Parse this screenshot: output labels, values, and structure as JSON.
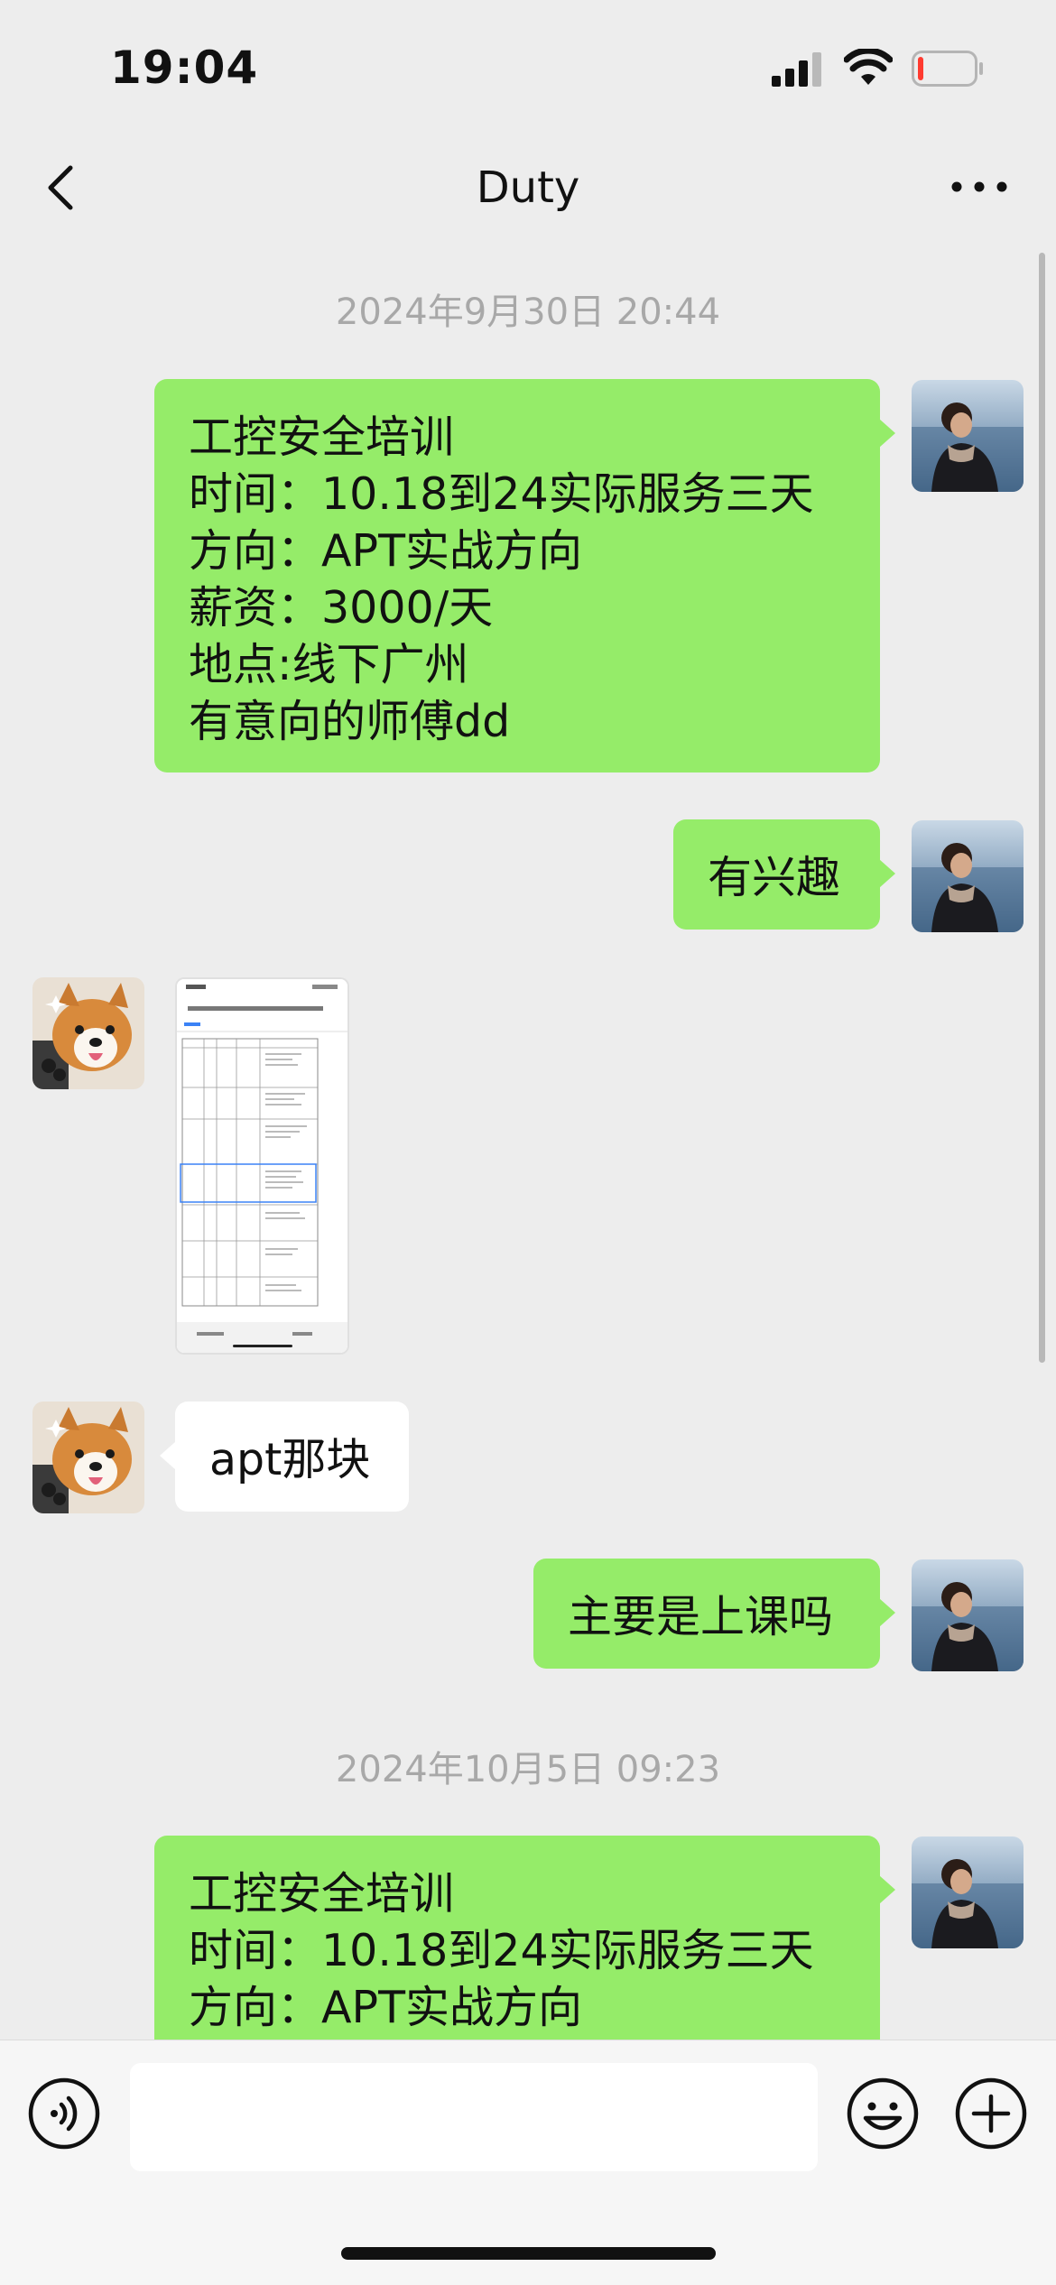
{
  "status_bar": {
    "time": "19:04",
    "battery_level": 0.1
  },
  "nav": {
    "title": "Duty"
  },
  "conversation": {
    "timestamps": [
      "2024年9月30日 20:44",
      "2024年10月5日 09:23"
    ],
    "messages": [
      {
        "sender": "me",
        "lines": [
          "工控安全培训",
          "时间：10.18到24实际服务三天",
          "方向：APT实战方向",
          "薪资：3000/天",
          "地点:线下广州",
          "有意向的师傅dd"
        ]
      },
      {
        "sender": "me",
        "text": "有兴趣"
      },
      {
        "sender": "them",
        "type": "image",
        "content": "spreadsheet-screenshot"
      },
      {
        "sender": "them",
        "text": "apt那块"
      },
      {
        "sender": "me",
        "text": "主要是上课吗"
      },
      {
        "sender": "me",
        "lines": [
          "工控安全培训",
          "时间：10.18到24实际服务三天",
          "方向：APT实战方向"
        ]
      }
    ]
  },
  "colors": {
    "my_bubble": "#95ec69",
    "their_bubble": "#ffffff",
    "background": "#ededed"
  },
  "icons": [
    "back-icon",
    "more-icon",
    "voice-icon",
    "emoji-icon",
    "plus-icon"
  ]
}
